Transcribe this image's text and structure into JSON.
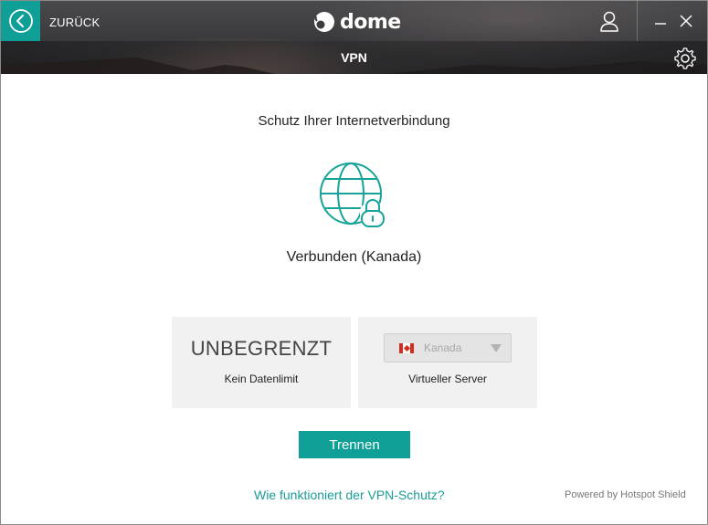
{
  "titlebar": {
    "back_label": "ZURÜCK",
    "brand": "dome",
    "page_title": "VPN",
    "icons": {
      "back": "chevron-left-icon",
      "user": "user-icon",
      "minimize": "minimize-icon",
      "close": "close-icon",
      "settings": "gear-icon"
    }
  },
  "main": {
    "heading": "Schutz Ihrer Internetverbindung",
    "icon": "globe-lock-icon",
    "status": "Verbunden (Kanada)"
  },
  "cards": {
    "data_limit": {
      "value": "UNBEGRENZT",
      "label": "Kein Datenlimit"
    },
    "server": {
      "selected": "Kanada",
      "flag": "canada-flag-icon",
      "label": "Virtueller Server"
    }
  },
  "actions": {
    "disconnect_label": "Trennen",
    "help_link": "Wie funktioniert der VPN-Schutz?"
  },
  "footer": {
    "powered_by": "Powered by Hotspot Shield"
  },
  "colors": {
    "accent": "#0f9f97",
    "link": "#1a9d96",
    "card_bg": "#f1f1f1"
  }
}
